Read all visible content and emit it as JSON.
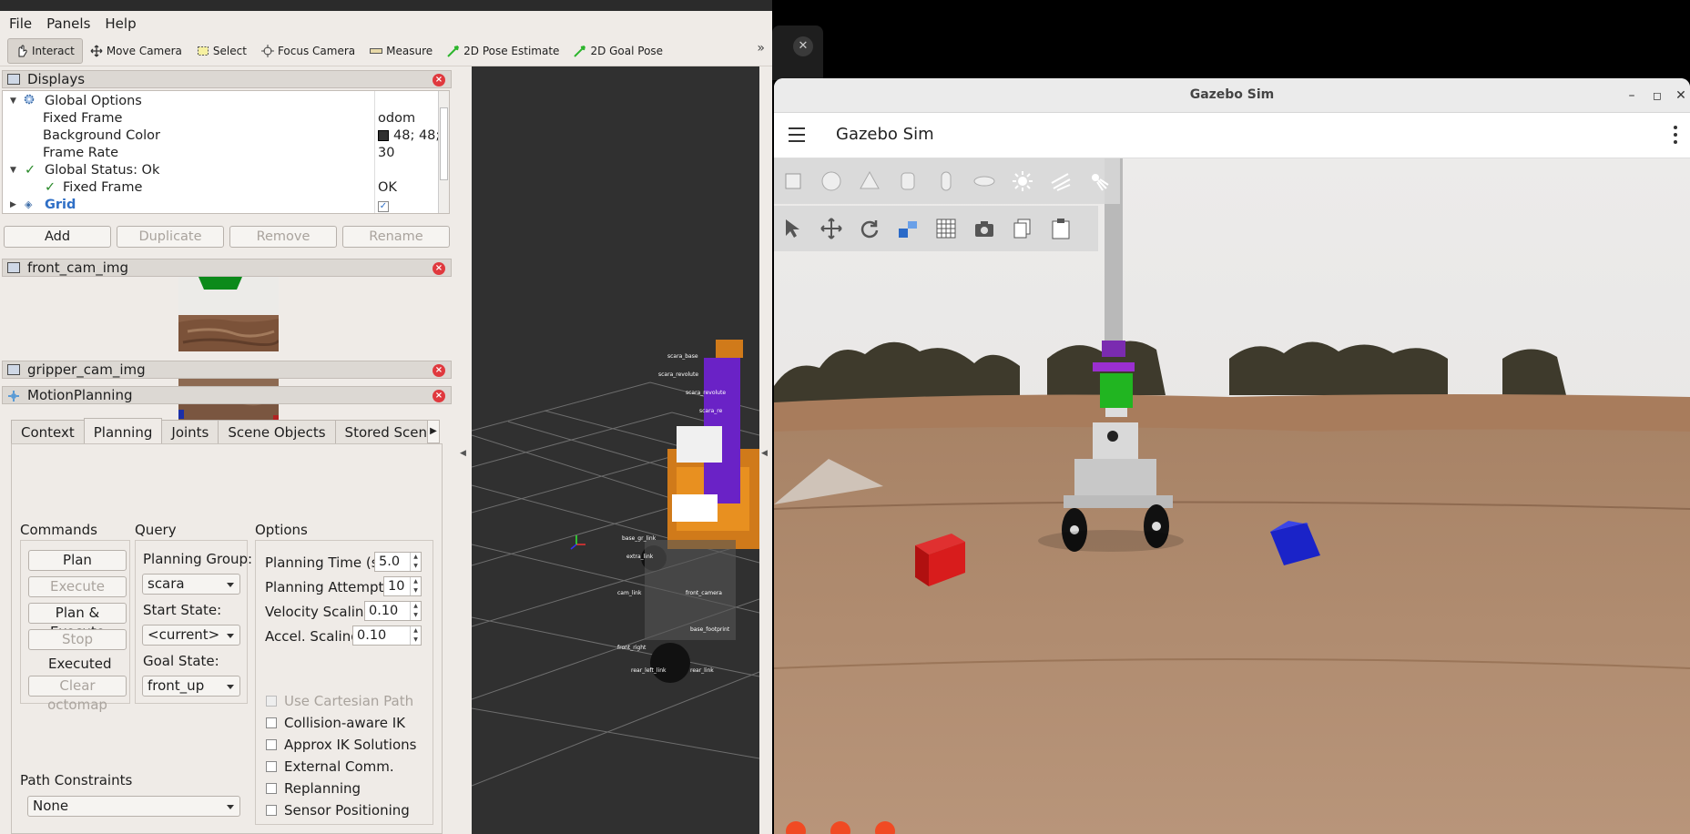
{
  "rviz": {
    "menu": {
      "file": "File",
      "panels": "Panels",
      "help": "Help"
    },
    "toolbar": {
      "interact": "Interact",
      "move_camera": "Move Camera",
      "select": "Select",
      "focus_camera": "Focus Camera",
      "measure": "Measure",
      "pose_estimate": "2D Pose Estimate",
      "goal_pose": "2D Goal Pose",
      "more": "»"
    },
    "displays": {
      "title": "Displays",
      "global_options": "Global Options",
      "fixed_frame_label": "Fixed Frame",
      "fixed_frame_value": "odom",
      "background_color_label": "Background Color",
      "background_color_value": "48; 48;",
      "frame_rate_label": "Frame Rate",
      "frame_rate_value": "30",
      "global_status": "Global Status: Ok",
      "status_fixed_frame": "Fixed Frame",
      "status_fixed_frame_value": "OK",
      "grid": "Grid"
    },
    "display_buttons": {
      "add": "Add",
      "duplicate": "Duplicate",
      "remove": "Remove",
      "rename": "Rename"
    },
    "front_cam_title": "front_cam_img",
    "gripper_cam_title": "gripper_cam_img",
    "motion_planning": {
      "title": "MotionPlanning",
      "tabs": [
        "Context",
        "Planning",
        "Joints",
        "Scene Objects",
        "Stored Scene"
      ],
      "commands_title": "Commands",
      "plan": "Plan",
      "execute": "Execute",
      "plan_execute": "Plan & Execute",
      "stop": "Stop",
      "status": "Executed",
      "clear_octomap": "Clear octomap",
      "query_title": "Query",
      "planning_group_label": "Planning Group:",
      "planning_group_value": "scara",
      "start_state_label": "Start State:",
      "start_state_value": "<current>",
      "goal_state_label": "Goal State:",
      "goal_state_value": "front_up",
      "options_title": "Options",
      "planning_time_label": "Planning Time (s):",
      "planning_time_value": "5.0",
      "planning_attempts_label": "Planning Attempts:",
      "planning_attempts_value": "10",
      "velocity_scaling_label": "Velocity Scaling:",
      "velocity_scaling_value": "0.10",
      "accel_scaling_label": "Accel. Scaling:",
      "accel_scaling_value": "0.10",
      "use_cartesian": "Use Cartesian Path",
      "collision_aware": "Collision-aware IK",
      "approx_ik": "Approx IK Solutions",
      "external_comm": "External Comm.",
      "replanning": "Replanning",
      "sensor_positioning": "Sensor Positioning",
      "path_constraints_label": "Path Constraints",
      "path_constraints_value": "None"
    }
  },
  "gazebo": {
    "window_title": "Gazebo Sim",
    "app_title": "Gazebo Sim"
  },
  "colors": {
    "rviz_bg": "#efebe7",
    "viewport_bg": "#303030",
    "accent_red": "#e0393e"
  }
}
